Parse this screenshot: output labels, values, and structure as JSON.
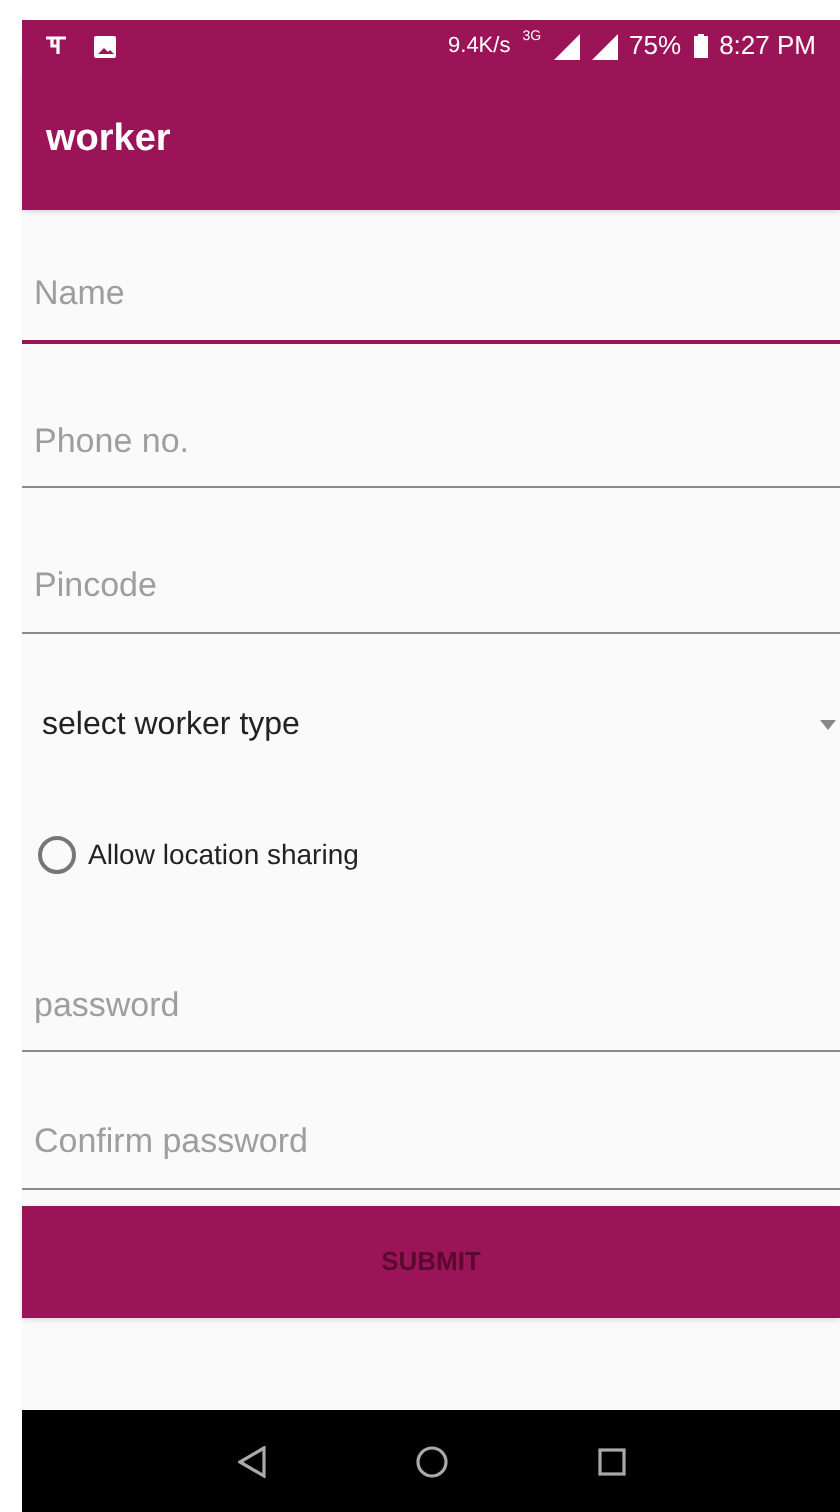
{
  "status_bar": {
    "speed": "9.4K/s",
    "network": "3G",
    "battery": "75%",
    "time": "8:27 PM"
  },
  "app_bar": {
    "title": "worker"
  },
  "fields_top": [
    {
      "placeholder": "Name",
      "focused": true
    },
    {
      "placeholder": "Phone no.",
      "focused": false
    },
    {
      "placeholder": "Pincode",
      "focused": false
    }
  ],
  "worker_type": {
    "value": "select worker type"
  },
  "location_sharing": {
    "label": "Allow location sharing",
    "checked": false
  },
  "fields_bottom": [
    {
      "placeholder": "password",
      "focused": false
    },
    {
      "placeholder": "Confirm password",
      "focused": false
    }
  ],
  "submit": {
    "label": "SUBMIT"
  }
}
